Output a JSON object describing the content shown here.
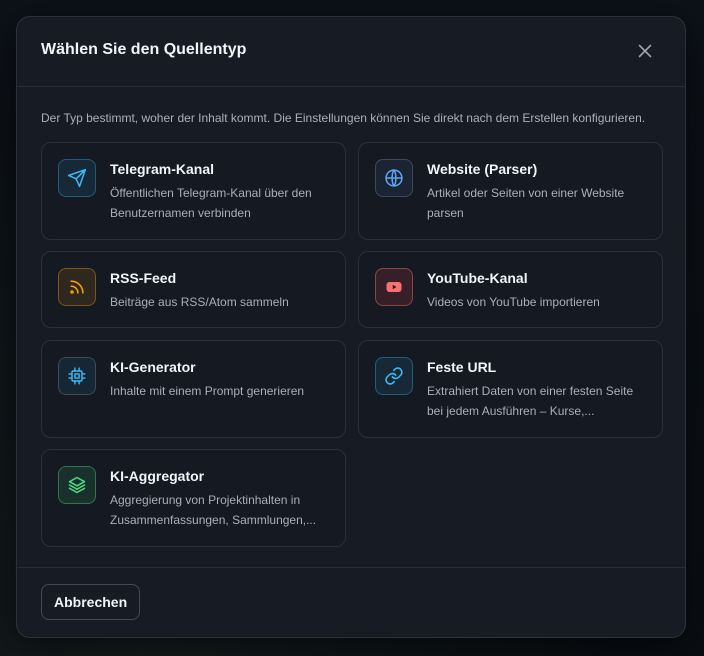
{
  "dialog": {
    "title": "Wählen Sie den Quellentyp",
    "description": "Der Typ bestimmt, woher der Inhalt kommt. Die Einstellungen können Sie direkt nach dem Erstellen konfigurieren.",
    "close_icon": "close-icon"
  },
  "source_types": [
    {
      "title": "Telegram-Kanal",
      "description": "Öffentlichen Telegram-Kanal über den Benutzernamen verbinden",
      "icon": "send-icon",
      "accent": "#38bdf8"
    },
    {
      "title": "Website (Parser)",
      "description": "Artikel oder Seiten von einer Website parsen",
      "icon": "globe-icon",
      "accent": "#60a5fa"
    },
    {
      "title": "RSS-Feed",
      "description": "Beiträge aus RSS/Atom sammeln",
      "icon": "rss-icon",
      "accent": "#f59e0b"
    },
    {
      "title": "YouTube-Kanal",
      "description": "Videos von YouTube importieren",
      "icon": "youtube-icon",
      "accent": "#f87171"
    },
    {
      "title": "KI-Generator",
      "description": "Inhalte mit einem Prompt generieren",
      "icon": "cpu-icon",
      "accent": "#38bdf8"
    },
    {
      "title": "Feste URL",
      "description": "Extrahiert Daten von einer festen Seite bei jedem Ausführen – Kurse,...",
      "icon": "link-icon",
      "accent": "#38bdf8"
    },
    {
      "title": "KI-Aggregator",
      "description": "Aggregierung von Projektinhalten in Zusammenfassungen, Sammlungen,...",
      "icon": "layers-icon",
      "accent": "#4ade80"
    }
  ],
  "footer": {
    "cancel_label": "Abbrechen"
  }
}
